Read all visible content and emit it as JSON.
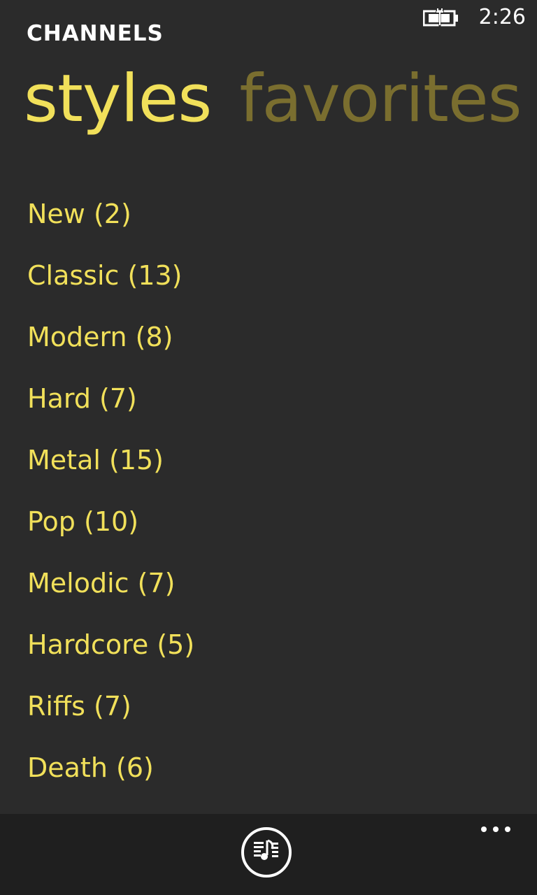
{
  "status_bar": {
    "time": "2:26",
    "battery_icon": "battery-charging-icon"
  },
  "header": {
    "title": "CHANNELS"
  },
  "pivot": {
    "items": [
      {
        "label": "styles",
        "active": true
      },
      {
        "label": "favorites",
        "active": false
      }
    ]
  },
  "styles": {
    "items": [
      {
        "label": "New (2)"
      },
      {
        "label": "Classic (13)"
      },
      {
        "label": "Modern (8)"
      },
      {
        "label": "Hard (7)"
      },
      {
        "label": "Metal (15)"
      },
      {
        "label": "Pop (10)"
      },
      {
        "label": "Melodic (7)"
      },
      {
        "label": "Hardcore (5)"
      },
      {
        "label": "Riffs (7)"
      },
      {
        "label": "Death (6)"
      }
    ]
  },
  "app_bar": {
    "button_icon": "playlist-music-icon",
    "more_icon": "more-icon"
  },
  "colors": {
    "background": "#2b2b2b",
    "accent": "#f1e05a",
    "inactive_pivot": "#7a6e2f",
    "app_bar": "#1f1f1f",
    "text": "#ffffff"
  }
}
